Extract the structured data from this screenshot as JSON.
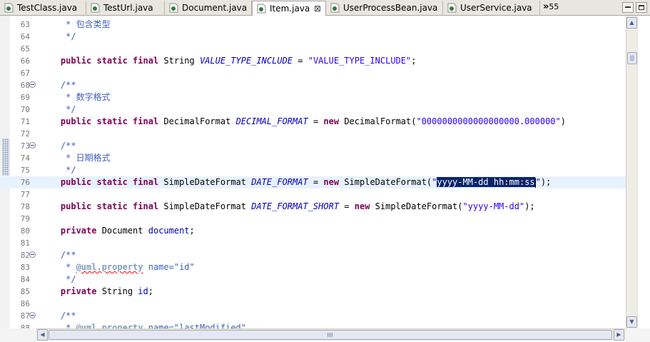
{
  "tabs": [
    {
      "label": "TestClass.java"
    },
    {
      "label": "TestUrl.java"
    },
    {
      "label": "Document.java"
    },
    {
      "label": "Item.java",
      "close": "⊠"
    },
    {
      "label": "UserProcessBean.java"
    },
    {
      "label": "UserService.java"
    }
  ],
  "overflow": {
    "chevron": "»",
    "count": "55"
  },
  "icons": {
    "java_file": "java-file-icon",
    "fold": "fold-collapse-icon"
  },
  "colors": {
    "keyword": "#7f0055",
    "comment": "#3f5fbf",
    "javadoc_tag": "#7f9fbf",
    "field": "#0000c0",
    "string": "#2a00ff",
    "selection": "#0a246a",
    "current_line": "#e8f2fe"
  },
  "editor": {
    "current_line": "76",
    "lines": [
      {
        "num": "63",
        "parts": [
          {
            "t": "     * 包含类型",
            "c": "cm"
          }
        ]
      },
      {
        "num": "64",
        "parts": [
          {
            "t": "     */",
            "c": "cm"
          }
        ]
      },
      {
        "num": "65",
        "parts": []
      },
      {
        "num": "66",
        "parts": [
          {
            "t": "    "
          },
          {
            "t": "public static final",
            "c": "kw"
          },
          {
            "t": " String "
          },
          {
            "t": "VALUE_TYPE_INCLUDE",
            "c": "fld"
          },
          {
            "t": " = "
          },
          {
            "t": "\"VALUE_TYPE_INCLUDE\"",
            "c": "str"
          },
          {
            "t": ";"
          }
        ]
      },
      {
        "num": "67",
        "parts": []
      },
      {
        "num": "68",
        "fold": true,
        "parts": [
          {
            "t": "    /**",
            "c": "cm"
          }
        ]
      },
      {
        "num": "69",
        "parts": [
          {
            "t": "     * 数字格式",
            "c": "cm"
          }
        ]
      },
      {
        "num": "70",
        "parts": [
          {
            "t": "     */",
            "c": "cm"
          }
        ]
      },
      {
        "num": "71",
        "parts": [
          {
            "t": "    "
          },
          {
            "t": "public static final",
            "c": "kw"
          },
          {
            "t": " DecimalFormat "
          },
          {
            "t": "DECIMAL_FORMAT",
            "c": "fld"
          },
          {
            "t": " = "
          },
          {
            "t": "new",
            "c": "kw"
          },
          {
            "t": " DecimalFormat("
          },
          {
            "t": "\"0000000000000000000.000000\"",
            "c": "str"
          },
          {
            "t": ")"
          }
        ]
      },
      {
        "num": "72",
        "parts": []
      },
      {
        "num": "73",
        "fold": true,
        "parts": [
          {
            "t": "    /**",
            "c": "cm"
          }
        ]
      },
      {
        "num": "74",
        "parts": [
          {
            "t": "     * 日期格式",
            "c": "cm"
          }
        ]
      },
      {
        "num": "75",
        "parts": [
          {
            "t": "     */",
            "c": "cm"
          }
        ]
      },
      {
        "num": "76",
        "parts": [
          {
            "t": "    "
          },
          {
            "t": "public static final",
            "c": "kw"
          },
          {
            "t": " SimpleDateFormat "
          },
          {
            "t": "DATE_FORMAT",
            "c": "fld"
          },
          {
            "t": " = "
          },
          {
            "t": "new",
            "c": "kw"
          },
          {
            "t": " SimpleDateFormat("
          },
          {
            "t": "\"",
            "c": "str"
          },
          {
            "t": "yyyy-MM-dd hh:mm:ss",
            "c": "sel"
          },
          {
            "cursor": true
          },
          {
            "t": "\"",
            "c": "str"
          },
          {
            "t": ");"
          }
        ]
      },
      {
        "num": "77",
        "parts": []
      },
      {
        "num": "78",
        "parts": [
          {
            "t": "    "
          },
          {
            "t": "public static final",
            "c": "kw"
          },
          {
            "t": " SimpleDateFormat "
          },
          {
            "t": "DATE_FORMAT_SHORT",
            "c": "fld"
          },
          {
            "t": " = "
          },
          {
            "t": "new",
            "c": "kw"
          },
          {
            "t": " SimpleDateFormat("
          },
          {
            "t": "\"yyyy-MM-dd\"",
            "c": "str"
          },
          {
            "t": ");"
          }
        ]
      },
      {
        "num": "79",
        "parts": []
      },
      {
        "num": "80",
        "parts": [
          {
            "t": "    "
          },
          {
            "t": "private",
            "c": "kw"
          },
          {
            "t": " Document "
          },
          {
            "t": "document",
            "c": "ifld"
          },
          {
            "t": ";"
          }
        ]
      },
      {
        "num": "81",
        "parts": []
      },
      {
        "num": "82",
        "fold": true,
        "parts": [
          {
            "t": "    /**",
            "c": "cm"
          }
        ]
      },
      {
        "num": "83",
        "parts": [
          {
            "t": "     * ",
            "c": "cm"
          },
          {
            "t": "@uml.property",
            "c": "tag squiggle"
          },
          {
            "t": " name=\"id\"",
            "c": "cm"
          }
        ]
      },
      {
        "num": "84",
        "parts": [
          {
            "t": "     */",
            "c": "cm"
          }
        ]
      },
      {
        "num": "85",
        "parts": [
          {
            "t": "    "
          },
          {
            "t": "private",
            "c": "kw"
          },
          {
            "t": " String "
          },
          {
            "t": "id",
            "c": "ifld"
          },
          {
            "t": ";"
          }
        ]
      },
      {
        "num": "86",
        "parts": []
      },
      {
        "num": "87",
        "fold": true,
        "parts": [
          {
            "t": "    /**",
            "c": "cm"
          }
        ]
      },
      {
        "num": "88",
        "parts": [
          {
            "t": "     * ",
            "c": "cm"
          },
          {
            "t": "@uml.property",
            "c": "tag squiggle"
          },
          {
            "t": " name=\"lastModified\"",
            "c": "cm"
          }
        ]
      }
    ]
  },
  "scrollbars": {
    "up": "▲",
    "down": "▼",
    "left": "◀",
    "right": "▶"
  }
}
